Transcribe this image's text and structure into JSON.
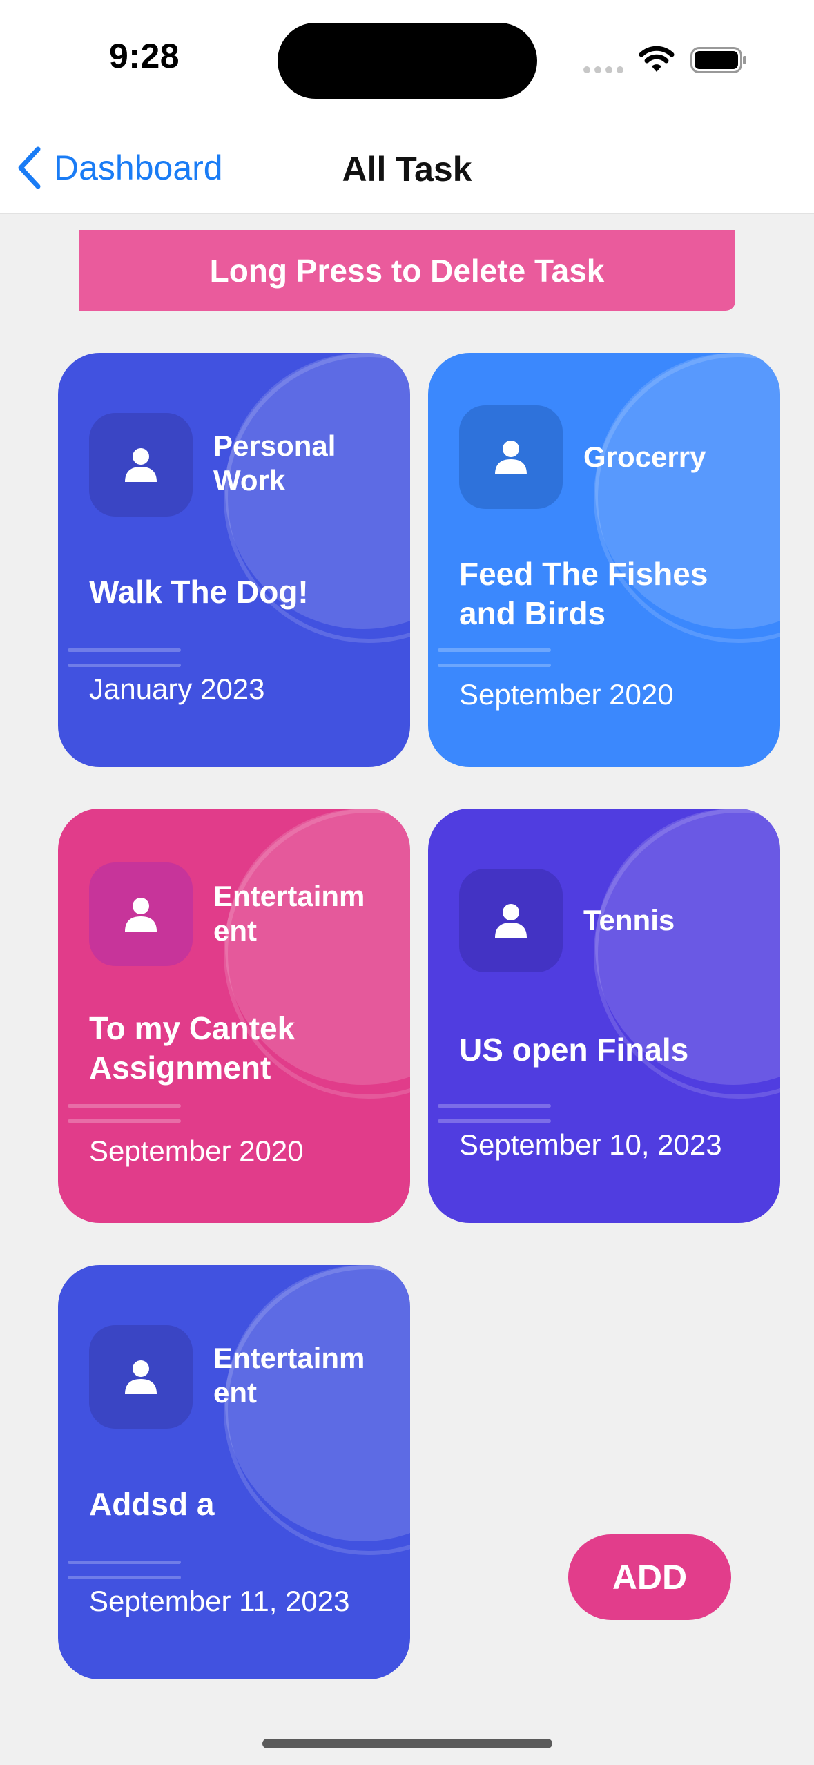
{
  "status_bar": {
    "time": "9:28"
  },
  "nav": {
    "back_label": "Dashboard",
    "title": "All Task"
  },
  "banner": {
    "text": "Long Press to Delete Task"
  },
  "cards": [
    {
      "category": "Personal\nWork",
      "title": "Walk The Dog!",
      "date": "January 2023",
      "color": "#4152e0",
      "icon": "person-icon"
    },
    {
      "category": "Grocerry",
      "title": "Feed The Fishes and Birds",
      "date": "September 2020",
      "color": "#3b88fd",
      "icon": "person-icon"
    },
    {
      "category": "Entertainm\nent",
      "title": "To my Cantek Assignment",
      "date": "September 2020",
      "color": "#e13c8a",
      "icon": "person-icon"
    },
    {
      "category": "Tennis",
      "title": "US open Finals",
      "date": "September 10, 2023",
      "color": "#503de0",
      "icon": "person-icon"
    },
    {
      "category": "Entertainm\nent",
      "title": "Addsd a",
      "date": "September 11, 2023",
      "color": "#4152e0",
      "icon": "person-icon"
    }
  ],
  "add_button": {
    "label": "ADD"
  }
}
